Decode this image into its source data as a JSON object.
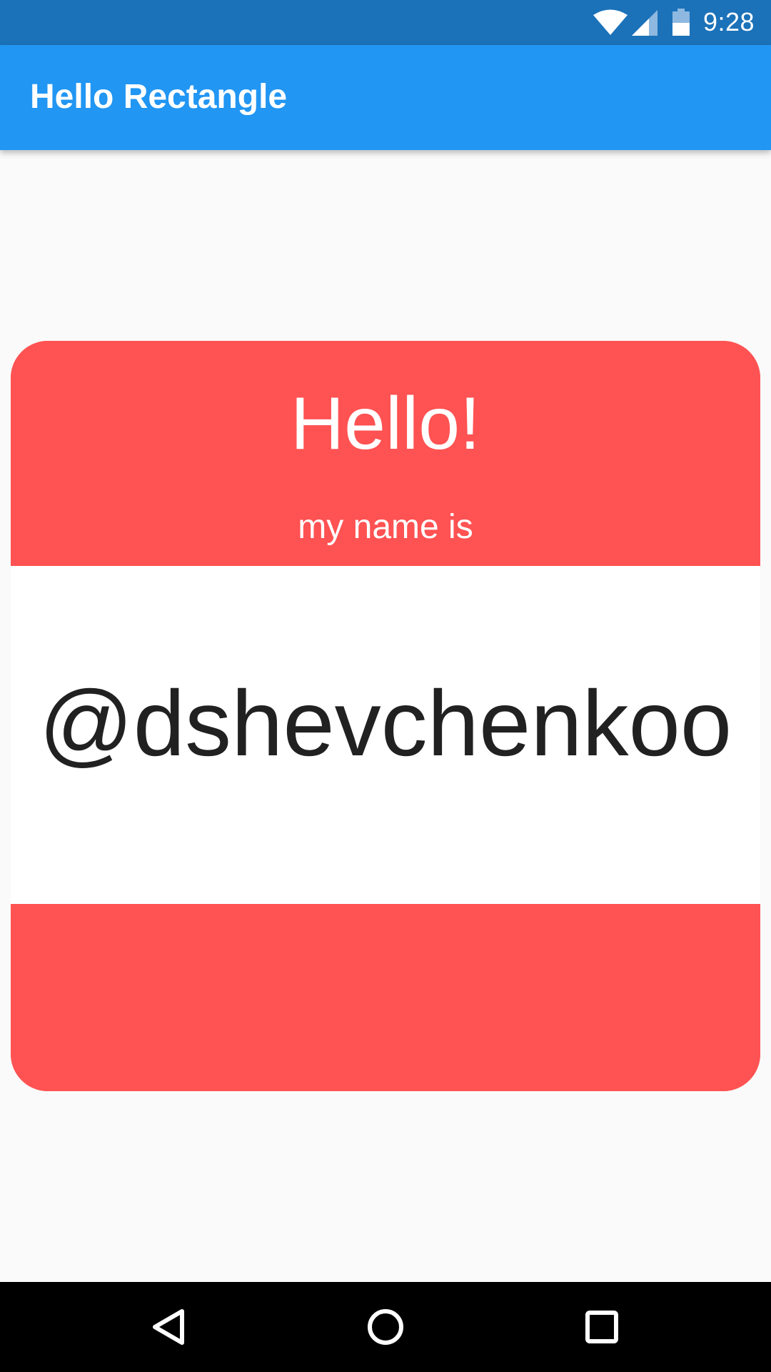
{
  "status_bar": {
    "time": "9:28",
    "icons": [
      "wifi-icon",
      "cell-signal-icon",
      "battery-icon"
    ],
    "background": "#1b72b9"
  },
  "app_bar": {
    "title": "Hello Rectangle",
    "background": "#2196f3"
  },
  "card": {
    "greeting": "Hello!",
    "subtitle": "my name is",
    "username": "@dshevchenkoo",
    "accent_color": "#ff5252",
    "name_panel_color": "#ffffff"
  },
  "nav_bar": {
    "buttons": [
      "back-icon",
      "home-icon",
      "recents-icon"
    ],
    "background": "#000000"
  }
}
